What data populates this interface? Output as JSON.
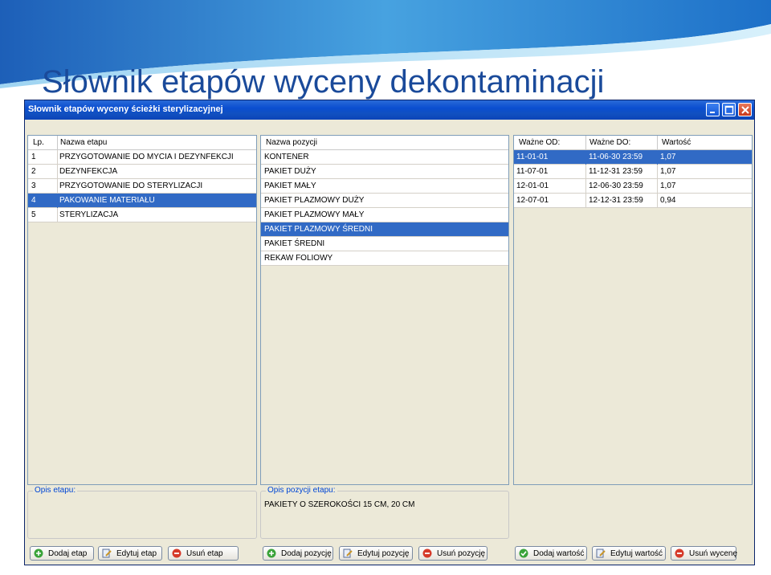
{
  "slide": {
    "title": "Słownik etapów wyceny dekontaminacji"
  },
  "window": {
    "title": "Słownik etapów wyceny ścieżki sterylizacyjnej"
  },
  "stages": {
    "headers": {
      "lp": "Lp.",
      "name": "Nazwa etapu"
    },
    "rows": [
      {
        "lp": "1",
        "name": "PRZYGOTOWANIE DO MYCIA I DEZYNFEKCJI"
      },
      {
        "lp": "2",
        "name": "DEZYNFEKCJA"
      },
      {
        "lp": "3",
        "name": "PRZYGOTOWANIE DO STERYLIZACJI"
      },
      {
        "lp": "4",
        "name": "PAKOWANIE MATERIAŁU"
      },
      {
        "lp": "5",
        "name": "STERYLIZACJA"
      }
    ],
    "selected_index": 3
  },
  "positions": {
    "headers": {
      "name": "Nazwa pozycji"
    },
    "rows": [
      {
        "name": "KONTENER"
      },
      {
        "name": "PAKIET DUŻY"
      },
      {
        "name": "PAKIET MAŁY"
      },
      {
        "name": "PAKIET PLAZMOWY DUŻY"
      },
      {
        "name": "PAKIET PLAZMOWY MAŁY"
      },
      {
        "name": "PAKIET PLAZMOWY ŚREDNI"
      },
      {
        "name": "PAKIET ŚREDNI"
      },
      {
        "name": "REKAW FOLIOWY"
      }
    ],
    "selected_index": 5
  },
  "values": {
    "headers": {
      "from": "Ważne OD:",
      "to": "Ważne DO:",
      "value": "Wartość"
    },
    "rows": [
      {
        "from": "11-01-01",
        "to": "11-06-30 23:59",
        "value": "1,07"
      },
      {
        "from": "11-07-01",
        "to": "11-12-31 23:59",
        "value": "1,07"
      },
      {
        "from": "12-01-01",
        "to": "12-06-30 23:59",
        "value": "1,07"
      },
      {
        "from": "12-07-01",
        "to": "12-12-31 23:59",
        "value": "0,94"
      }
    ],
    "selected_index": 0
  },
  "stage_description": {
    "label": "Opis etapu:",
    "text": ""
  },
  "position_description": {
    "label": "Opis pozycji etapu:",
    "text": "PAKIETY O SZEROKOŚCI 15 CM, 20 CM"
  },
  "buttons": {
    "add_stage": "Dodaj etap",
    "edit_stage": "Edytuj etap",
    "delete_stage": "Usuń etap",
    "add_position": "Dodaj pozycję",
    "edit_position": "Edytuj pozycję",
    "delete_position": "Usuń pozycję",
    "add_value": "Dodaj wartość",
    "edit_value": "Edytuj wartość",
    "delete_value": "Usuń wycenę"
  },
  "icons": {
    "add": "plus-circle-icon",
    "edit": "edit-document-icon",
    "delete": "minus-circle-icon",
    "confirm": "check-circle-icon"
  },
  "colors": {
    "selection": "#316ac5",
    "titlebar": "#0a4ed0",
    "slide_title": "#1a4a9a",
    "window_bg": "#ece9d8"
  }
}
